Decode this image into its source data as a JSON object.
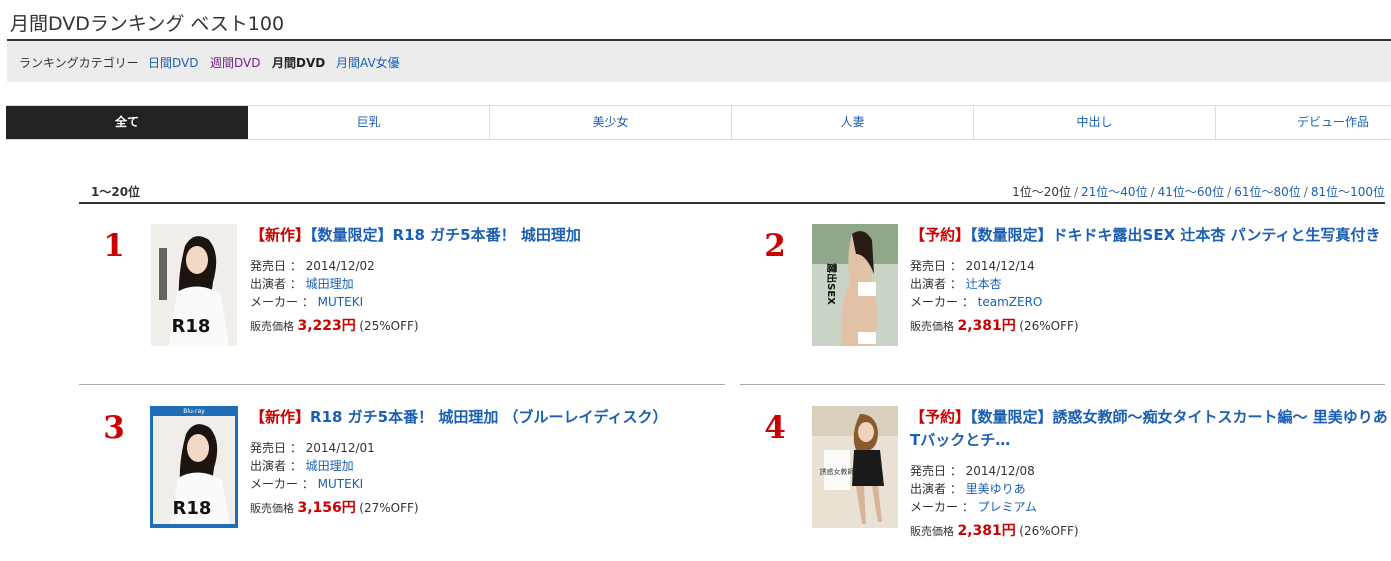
{
  "page": {
    "title": "月間DVDランキング ベスト100"
  },
  "categories": {
    "label": "ランキングカテゴリー",
    "items": [
      "日間DVD",
      "週間DVD",
      "月間DVD",
      "月間AV女優"
    ]
  },
  "tabs": [
    "全て",
    "巨乳",
    "美少女",
    "人妻",
    "中出し",
    "デビュー作品"
  ],
  "range": {
    "current": "1〜20位",
    "pager_current": "1位〜20位",
    "pages": [
      "21位〜40位",
      "41位〜60位",
      "61位〜80位",
      "81位〜100位"
    ],
    "separator": "/"
  },
  "labels": {
    "date": "発売日 ：",
    "cast": "出演者 ：",
    "maker": "メーカー ：",
    "price": "販売価格"
  },
  "items": [
    {
      "rank": "1",
      "tag": "【新作】",
      "title": "【数量限定】R18 ガチ5本番！ 城田理加",
      "date": "2014/12/02",
      "cast": "城田理加",
      "maker": "MUTEKI",
      "price": "3,223円",
      "off": "(25%OFF)",
      "cover_text": "R18"
    },
    {
      "rank": "2",
      "tag": "【予約】",
      "title": "【数量限定】ドキドキ露出SEX 辻本杏 パンティと生写真付き",
      "date": "2014/12/14",
      "cast": "辻本杏",
      "maker": "teamZERO",
      "price": "2,381円",
      "off": "(26%OFF)",
      "cover_text": "露出SEX"
    },
    {
      "rank": "3",
      "tag": "【新作】",
      "title": "R18 ガチ5本番！ 城田理加 （ブルーレイディスク）",
      "date": "2014/12/01",
      "cast": "城田理加",
      "maker": "MUTEKI",
      "price": "3,156円",
      "off": "(27%OFF)",
      "cover_text": "R18"
    },
    {
      "rank": "4",
      "tag": "【予約】",
      "title": "【数量限定】誘惑女教師〜痴女タイトスカート編〜 里美ゆりあ Tバックとチ…",
      "date": "2014/12/08",
      "cast": "里美ゆりあ",
      "maker": "プレミアム",
      "price": "2,381円",
      "off": "(26%OFF)",
      "cover_text": "誘惑女教師"
    }
  ],
  "colors": {
    "accent_red": "#cc0000",
    "link_blue": "#1a5fb4",
    "active_tab": "#222222"
  }
}
